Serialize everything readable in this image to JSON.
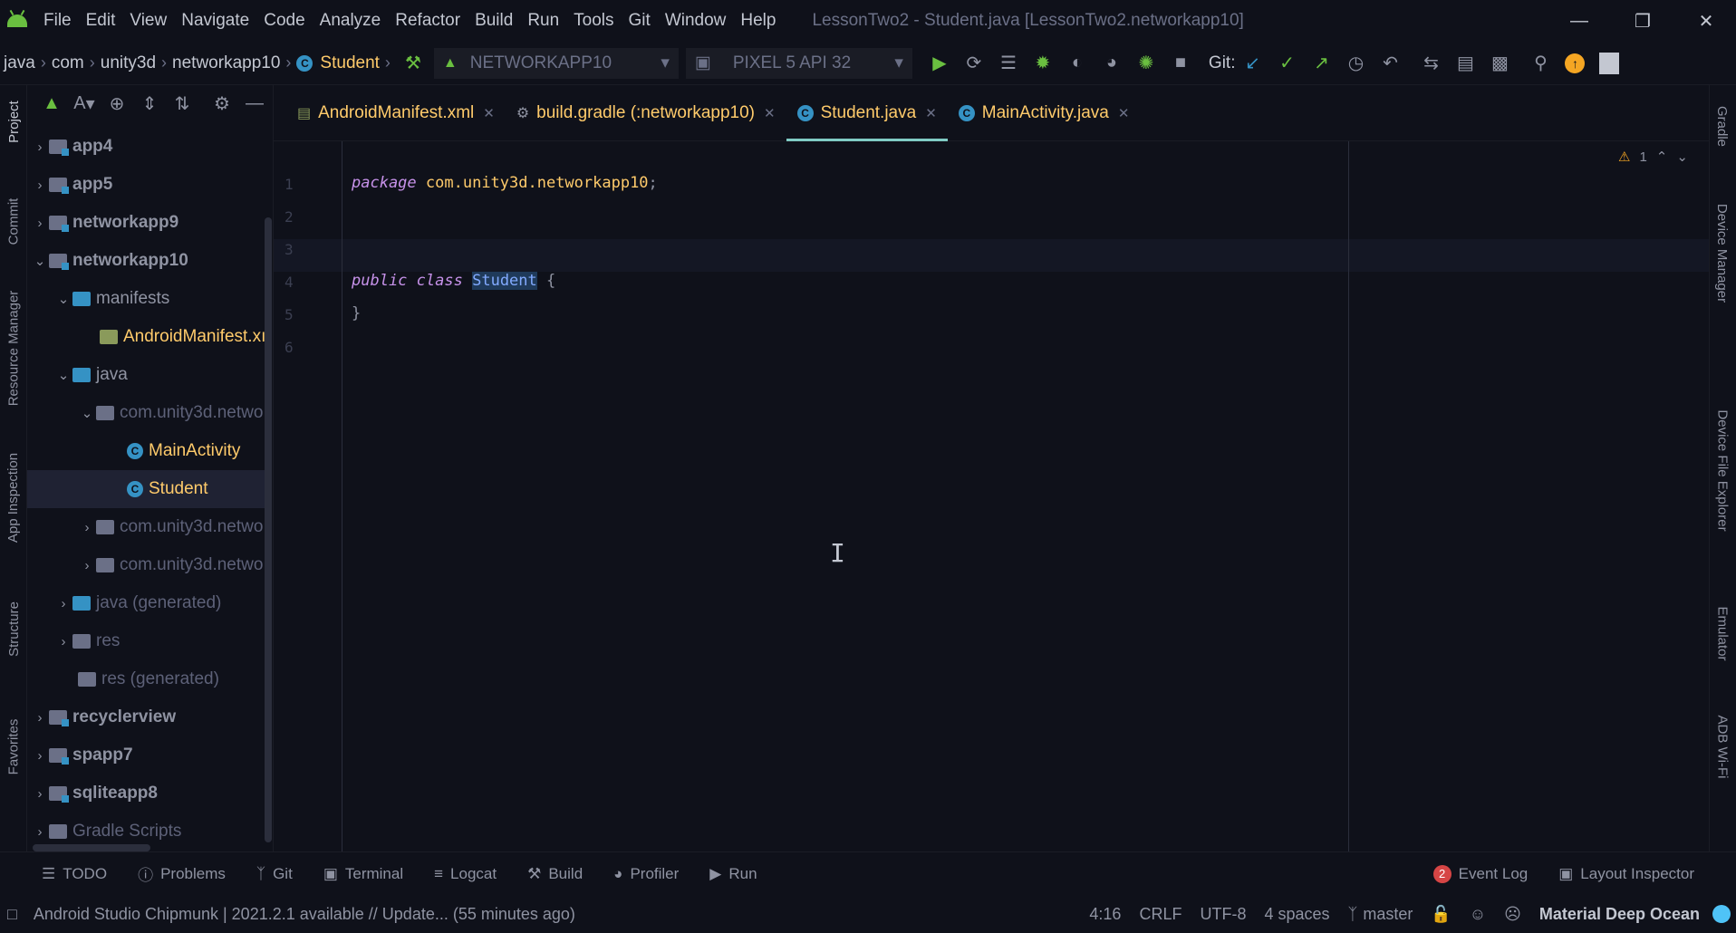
{
  "menu": {
    "items": [
      "File",
      "Edit",
      "View",
      "Navigate",
      "Code",
      "Analyze",
      "Refactor",
      "Build",
      "Run",
      "Tools",
      "Git",
      "Window",
      "Help"
    ],
    "window_title": "LessonTwo2 - Student.java [LessonTwo2.networkapp10]"
  },
  "nav": {
    "crumbs": [
      "java",
      "com",
      "unity3d",
      "networkapp10",
      "Student"
    ],
    "run_config": "NETWORKAPP10",
    "device": "PIXEL 5 API 32",
    "git_label": "Git:"
  },
  "left_tabs": [
    "Project",
    "Commit",
    "Resource Manager",
    "App Inspection",
    "Structure",
    "Favorites"
  ],
  "right_tabs": [
    "Gradle",
    "Device Manager",
    "Device File Explorer",
    "Emulator",
    "ADB Wi-Fi"
  ],
  "project_toolbar": {
    "view_label": "A"
  },
  "tree": [
    {
      "label": "app4"
    },
    {
      "label": "app5"
    },
    {
      "label": "networkapp9"
    },
    {
      "label": "networkapp10"
    },
    {
      "label": "manifests"
    },
    {
      "label": "AndroidManifest.xı"
    },
    {
      "label": "java"
    },
    {
      "label": "com.unity3d.netwo"
    },
    {
      "label": "MainActivity"
    },
    {
      "label": "Student"
    },
    {
      "label": "com.unity3d.netwo"
    },
    {
      "label": "com.unity3d.netwo"
    },
    {
      "label": "java (generated)"
    },
    {
      "label": "res"
    },
    {
      "label": "res (generated)"
    },
    {
      "label": "recyclerview"
    },
    {
      "label": "spapp7"
    },
    {
      "label": "sqliteapp8"
    },
    {
      "label": "Gradle Scripts"
    }
  ],
  "tabs": [
    {
      "label": "AndroidManifest.xml"
    },
    {
      "label": "build.gradle (:networkapp10)"
    },
    {
      "label": "Student.java"
    },
    {
      "label": "MainActivity.java"
    }
  ],
  "code": {
    "line_numbers": [
      "1",
      "2",
      "3",
      "4",
      "5",
      "6"
    ],
    "line1_kw": "package",
    "line1_pkg": "com.unity3d.networkapp10",
    "line1_semi": ";",
    "line4_kw1": "public",
    "line4_kw2": "class",
    "line4_name": "Student",
    "line4_brace": "{",
    "line5": "}",
    "warning_count": "1"
  },
  "bottom_tools": [
    "TODO",
    "Problems",
    "Git",
    "Terminal",
    "Logcat",
    "Build",
    "Profiler",
    "Run"
  ],
  "bottom_right": {
    "event_log_count": "2",
    "event_log": "Event Log",
    "layout_inspector": "Layout Inspector"
  },
  "status": {
    "message": "Android Studio Chipmunk | 2021.2.1 available // Update... (55 minutes ago)",
    "position": "4:16",
    "line_sep": "CRLF",
    "encoding": "UTF-8",
    "indent": "4 spaces",
    "branch": "master",
    "theme": "Material Deep Ocean"
  }
}
